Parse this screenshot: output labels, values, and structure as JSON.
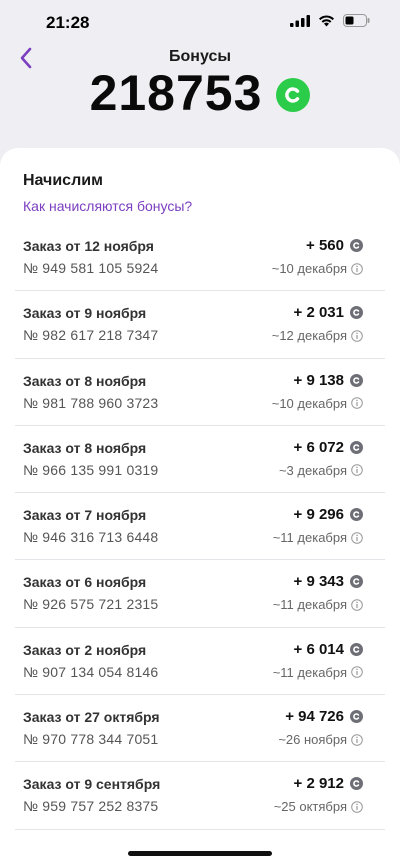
{
  "status_bar": {
    "time": "21:28"
  },
  "header": {
    "title": "Бонусы",
    "balance": "218753",
    "back_icon": "chevron-left-icon",
    "bonus_icon": "bonus-coin-icon"
  },
  "section": {
    "title": "Начислим",
    "how_link": "Как начисляются бонусы?"
  },
  "orders": [
    {
      "title": "Заказ от 12 ноября",
      "number": "№ 949 581 105 5924",
      "amount": "+ 560",
      "date": "~10 декабря"
    },
    {
      "title": "Заказ от 9 ноября",
      "number": "№ 982 617 218 7347",
      "amount": "+ 2 031",
      "date": "~12 декабря"
    },
    {
      "title": "Заказ от 8 ноября",
      "number": "№ 981 788 960 3723",
      "amount": "+ 9 138",
      "date": "~10 декабря"
    },
    {
      "title": "Заказ от 8 ноября",
      "number": "№ 966 135 991 0319",
      "amount": "+ 6 072",
      "date": "~3 декабря"
    },
    {
      "title": "Заказ от 7 ноября",
      "number": "№ 946 316 713 6448",
      "amount": "+ 9 296",
      "date": "~11 декабря"
    },
    {
      "title": "Заказ от 6 ноября",
      "number": "№ 926 575 721 2315",
      "amount": "+ 9 343",
      "date": "~11 декабря"
    },
    {
      "title": "Заказ от 2 ноября",
      "number": "№ 907 134 054 8146",
      "amount": "+ 6 014",
      "date": "~11 декабря"
    },
    {
      "title": "Заказ от 27 октября",
      "number": "№ 970 778 344 7051",
      "amount": "+ 94 726",
      "date": "~26 ноября"
    },
    {
      "title": "Заказ от 9 сентября",
      "number": "№ 959 757 252 8375",
      "amount": "+ 2 912",
      "date": "~25 октября"
    }
  ],
  "colors": {
    "accent": "#7b3fbf",
    "bonus_green": "#2bcc4a",
    "coin_gray": "#6e6e76",
    "background": "#efeff3"
  }
}
